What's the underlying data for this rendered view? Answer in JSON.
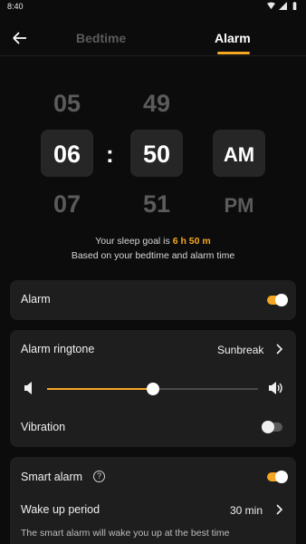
{
  "status_bar": {
    "time": "8:40",
    "icons": [
      "wifi-icon",
      "signal-icon",
      "battery-icon"
    ]
  },
  "header": {
    "back_icon": "arrow-left-icon",
    "tabs": [
      {
        "label": "Bedtime",
        "selected": false
      },
      {
        "label": "Alarm",
        "selected": true
      }
    ]
  },
  "time_picker": {
    "hour": {
      "prev": "05",
      "selected": "06",
      "next": "07"
    },
    "separator": ":",
    "minute": {
      "prev": "49",
      "selected": "50",
      "next": "51"
    },
    "period": {
      "selected": "AM",
      "next": "PM"
    }
  },
  "sleep_goal": {
    "prefix": "Your sleep goal is ",
    "value": "6 h 50 m",
    "subtitle": "Based on your bedtime and alarm time"
  },
  "alarm_card": {
    "label": "Alarm",
    "enabled": true
  },
  "ringtone_card": {
    "ringtone_label": "Alarm ringtone",
    "ringtone_value": "Sunbreak",
    "volume_level": 0.5,
    "volume_low_icon": "volume-low-icon",
    "volume_high_icon": "volume-high-icon",
    "vibration_label": "Vibration",
    "vibration_enabled": false
  },
  "smart_card": {
    "smart_label": "Smart alarm",
    "help_glyph": "?",
    "smart_enabled": true,
    "wake_label": "Wake up period",
    "wake_value": "30 min",
    "description": "The smart alarm will wake you up at the best time"
  },
  "colors": {
    "accent": "#f5a623",
    "background": "#0c0c0c",
    "card": "#1e1e1e",
    "dim": "#5b5b5b"
  }
}
